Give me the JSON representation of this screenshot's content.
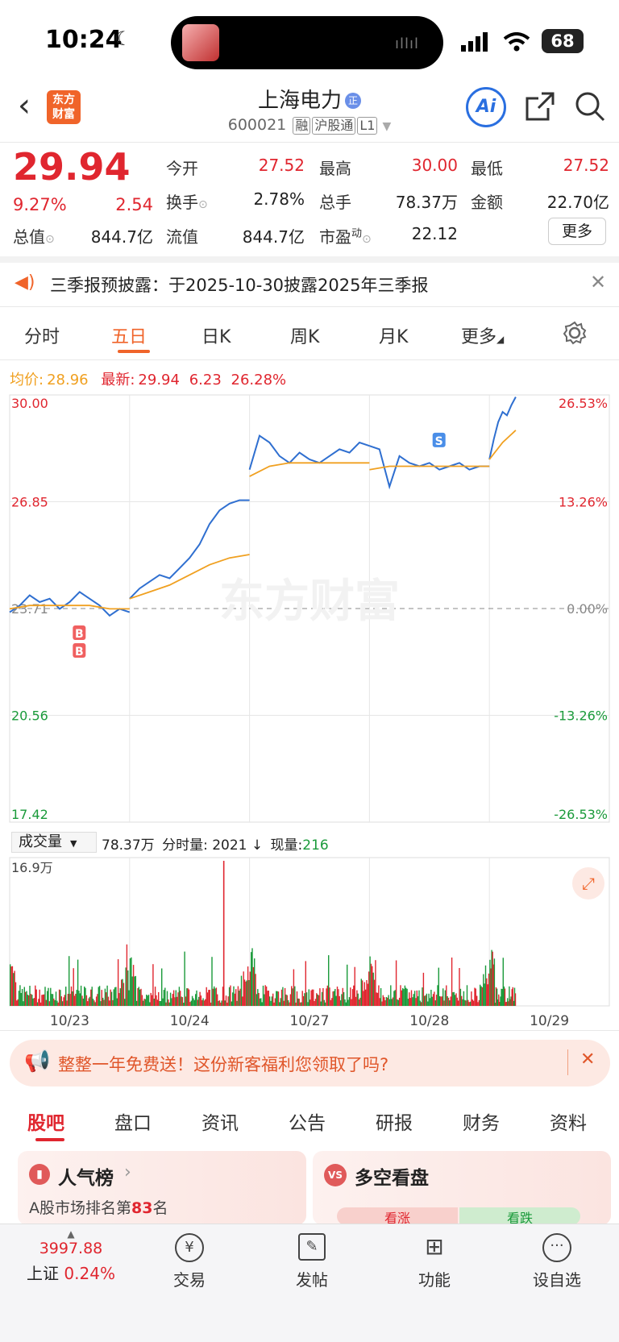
{
  "status_bar": {
    "time": "10:24",
    "battery": "68"
  },
  "header": {
    "logo_line1": "东方",
    "logo_line2": "财富",
    "stock_name": "上海电力",
    "code": "600021",
    "tags": [
      "融",
      "沪股通",
      "L1"
    ],
    "ai_label": "Ai"
  },
  "quote": {
    "price": "29.94",
    "change_pct": "9.27%",
    "change": "2.54",
    "open_label": "今开",
    "open": "27.52",
    "high_label": "最高",
    "high": "30.00",
    "low_label": "最低",
    "low": "27.52",
    "turnover_label": "换手",
    "turnover": "2.78%",
    "volume_label": "总手",
    "volume": "78.37万",
    "amount_label": "金额",
    "amount": "22.70亿",
    "mcap_label": "总值",
    "mcap": "844.7亿",
    "float_label": "流值",
    "float": "844.7亿",
    "pe_label": "市盈",
    "pe_sup": "动",
    "pe": "22.12",
    "more_button": "更多"
  },
  "notice": {
    "text": "三季报预披露：于2025-10-30披露2025年三季报"
  },
  "chart_tabs": [
    "分时",
    "五日",
    "日K",
    "周K",
    "月K",
    "更多"
  ],
  "active_chart_tab": "五日",
  "chart_info": {
    "avg_label": "均价:",
    "avg": "28.96",
    "latest_label": "最新:",
    "latest": "29.94",
    "chg": "6.23",
    "chg_pct": "26.28%"
  },
  "chart_data": {
    "type": "line",
    "title": "",
    "y_left_ticks": [
      "30.00",
      "26.85",
      "23.71",
      "20.56",
      "17.42"
    ],
    "y_right_ticks": [
      "26.53%",
      "13.26%",
      "0.00%",
      "-13.26%",
      "-26.53%"
    ],
    "ylim": [
      17.42,
      30.0
    ],
    "baseline": 23.71,
    "x_labels": [
      "10/23",
      "10/24",
      "10/27",
      "10/28",
      "10/29"
    ],
    "series": [
      {
        "name": "最新",
        "color": "#2f6fd0",
        "days": [
          [
            23.6,
            23.8,
            24.1,
            23.9,
            24.0,
            23.7,
            23.9,
            24.2,
            24.0,
            23.8,
            23.5,
            23.7,
            23.6
          ],
          [
            24.0,
            24.3,
            24.5,
            24.7,
            24.6,
            24.9,
            25.2,
            25.6,
            26.2,
            26.6,
            26.8,
            26.9,
            26.9
          ],
          [
            27.8,
            28.8,
            28.6,
            28.2,
            28.0,
            28.3,
            28.1,
            28.0,
            28.2,
            28.4,
            28.3,
            28.6,
            28.5
          ],
          [
            28.5,
            28.4,
            27.3,
            28.2,
            28.0,
            27.9,
            28.0,
            27.8,
            27.9,
            28.0,
            27.8,
            27.9,
            27.9
          ],
          [
            28.1,
            28.7,
            29.2,
            29.5,
            29.4,
            29.7,
            29.94
          ]
        ]
      },
      {
        "name": "均价",
        "color": "#f0a020",
        "days": [
          [
            23.7,
            23.8,
            23.8,
            23.8,
            23.8,
            23.7,
            23.7
          ],
          [
            24.0,
            24.2,
            24.4,
            24.7,
            25.0,
            25.2,
            25.3
          ],
          [
            27.6,
            27.9,
            28.0,
            28.0,
            28.0,
            28.0,
            28.0
          ],
          [
            27.8,
            27.9,
            27.9,
            27.9,
            27.9,
            27.9,
            27.9
          ],
          [
            28.1,
            28.6,
            28.96
          ]
        ]
      }
    ],
    "markers": [
      {
        "type": "B",
        "day": 0,
        "color": "#f06060"
      },
      {
        "type": "B",
        "day": 0,
        "color": "#f06060"
      },
      {
        "type": "S",
        "day": 3,
        "color": "#4a8ee8"
      }
    ],
    "volume": {
      "label": "成交量",
      "total": "78.37万",
      "tick_label": "分时量: 2021 ↓",
      "now_label": "现量:",
      "now": "216",
      "max_label": "16.9万"
    }
  },
  "promo": {
    "text": "整整一年免费送！这份新客福利您领取了吗?"
  },
  "bottom_tabs": [
    "股吧",
    "盘口",
    "资讯",
    "公告",
    "研报",
    "财务",
    "资料"
  ],
  "active_bottom_tab": "股吧",
  "cards": {
    "popular_title": "人气榜",
    "popular_text_prefix": "A股市场排名第",
    "popular_rank": "83",
    "popular_text_suffix": "名",
    "vs_title": "多空看盘",
    "vs_up": "看涨",
    "vs_down": "看跌"
  },
  "bottom_nav": {
    "index_value": "3997.88",
    "index_name": "上证",
    "index_change": "0.24%",
    "items": [
      "交易",
      "发帖",
      "功能",
      "设自选"
    ]
  }
}
